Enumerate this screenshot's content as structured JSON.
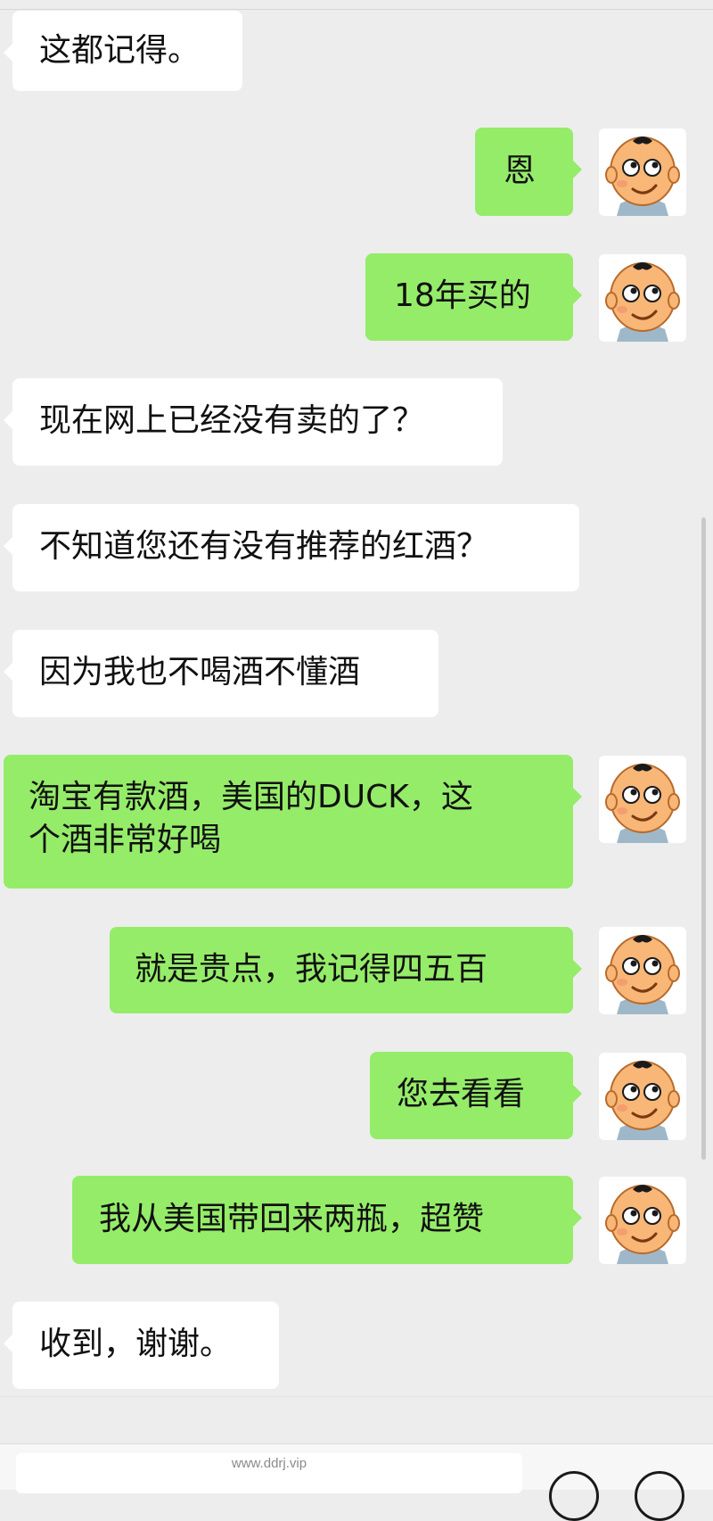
{
  "messages": [
    {
      "side": "in",
      "text": "这都记得。"
    },
    {
      "side": "out",
      "text": "恩"
    },
    {
      "side": "out",
      "text": "18年买的"
    },
    {
      "side": "in",
      "text": "现在网上已经没有卖的了？"
    },
    {
      "side": "in",
      "text": "不知道您还有没有推荐的红酒？"
    },
    {
      "side": "in",
      "text": "因为我也不喝酒不懂酒"
    },
    {
      "side": "out",
      "text_line1": "淘宝有款酒，美国的DUCK，这",
      "text_line2": "个酒非常好喝"
    },
    {
      "side": "out",
      "text": "就是贵点，我记得四五百"
    },
    {
      "side": "out",
      "text": "您去看看"
    },
    {
      "side": "out",
      "text": "我从美国带回来两瓶，超赞"
    },
    {
      "side": "in",
      "text": "收到，谢谢。"
    }
  ],
  "footer": {
    "site_url": "www.ddrj.vip"
  },
  "colors": {
    "background": "#ededed",
    "incoming_bubble": "#ffffff",
    "outgoing_bubble": "#95ec69"
  },
  "icons": {
    "avatar": "cartoon-baby-avatar-icon"
  }
}
